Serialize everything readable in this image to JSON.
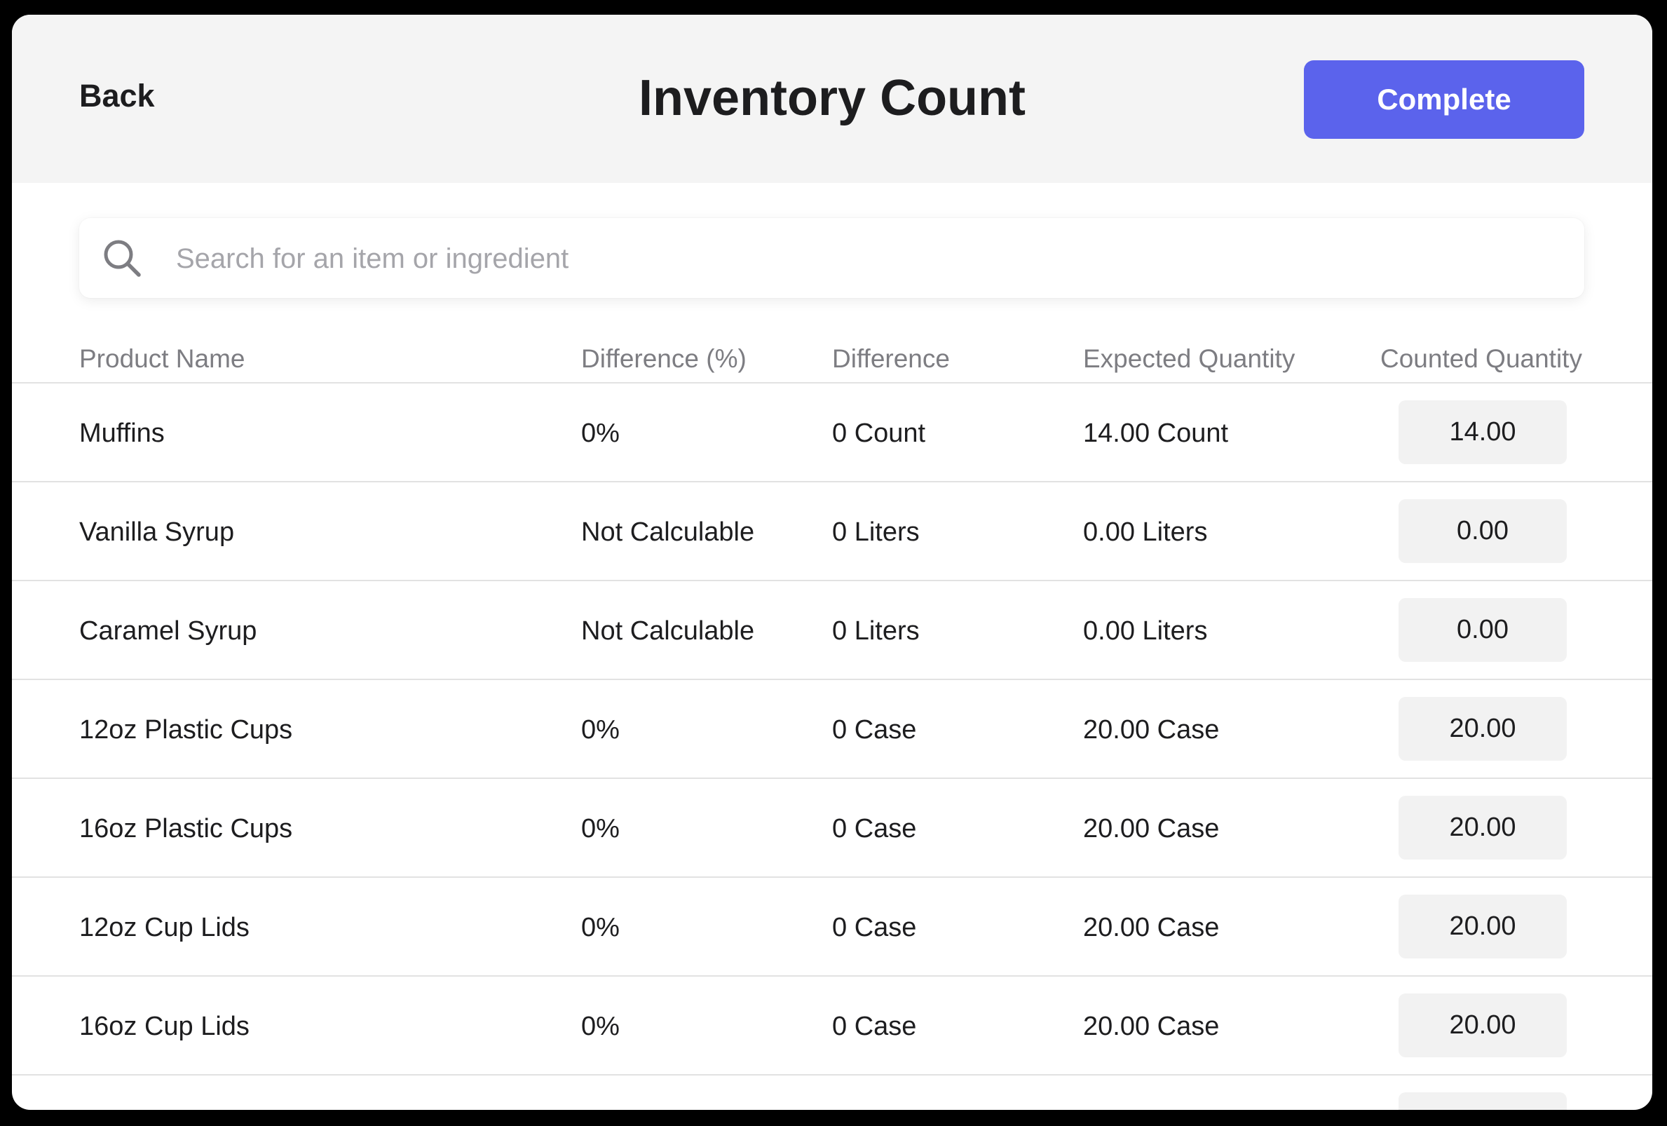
{
  "header": {
    "back_label": "Back",
    "title": "Inventory Count",
    "complete_label": "Complete"
  },
  "search": {
    "placeholder": "Search for an item or ingredient",
    "value": ""
  },
  "table": {
    "columns": {
      "product_name": "Product Name",
      "difference_pct": "Difference (%)",
      "difference": "Difference",
      "expected_quantity": "Expected Quantity",
      "counted_quantity": "Counted Quantity"
    },
    "rows": [
      {
        "name": "Muffins",
        "difference_pct": "0%",
        "difference": "0 Count",
        "expected": "14.00 Count",
        "counted": "14.00"
      },
      {
        "name": "Vanilla Syrup",
        "difference_pct": "Not Calculable",
        "difference": "0 Liters",
        "expected": "0.00 Liters",
        "counted": "0.00"
      },
      {
        "name": "Caramel Syrup",
        "difference_pct": "Not Calculable",
        "difference": "0 Liters",
        "expected": "0.00 Liters",
        "counted": "0.00"
      },
      {
        "name": "12oz Plastic Cups",
        "difference_pct": "0%",
        "difference": "0 Case",
        "expected": "20.00 Case",
        "counted": "20.00"
      },
      {
        "name": "16oz Plastic Cups",
        "difference_pct": "0%",
        "difference": "0 Case",
        "expected": "20.00 Case",
        "counted": "20.00"
      },
      {
        "name": "12oz Cup Lids",
        "difference_pct": "0%",
        "difference": "0 Case",
        "expected": "20.00 Case",
        "counted": "20.00"
      },
      {
        "name": "16oz Cup Lids",
        "difference_pct": "0%",
        "difference": "0 Case",
        "expected": "20.00 Case",
        "counted": "20.00"
      }
    ]
  },
  "colors": {
    "accent": "#5b63ec",
    "header_bg": "#f4f4f4",
    "input_bg": "#f2f2f2"
  },
  "icons": {
    "search": "search-icon"
  }
}
